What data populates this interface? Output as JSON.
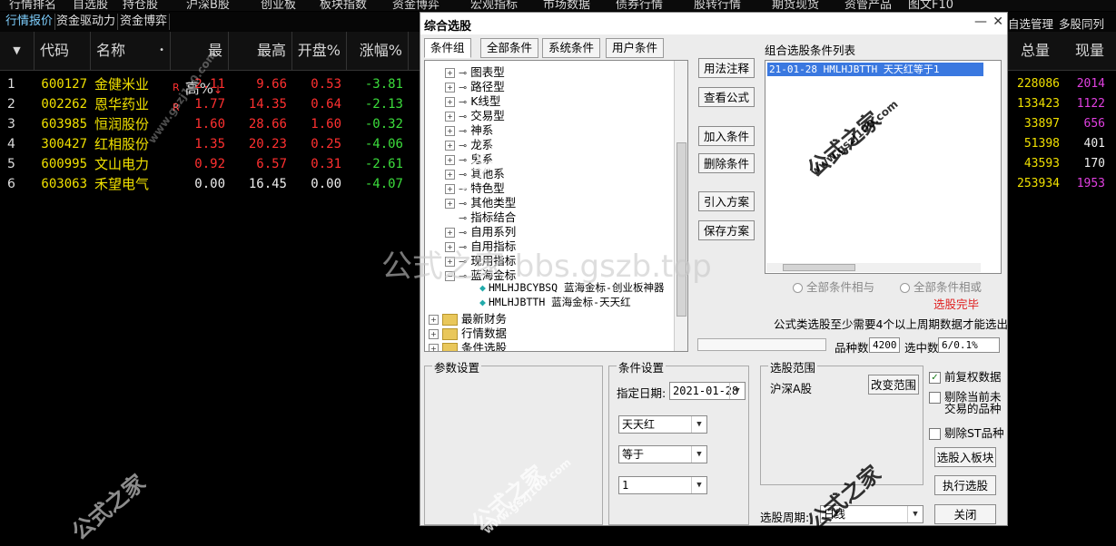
{
  "top_menu": [
    "行情排名",
    "自选股",
    "持仓股",
    "沪深B股",
    "创业板",
    "板块指数",
    "资金博弈",
    "宏观指标",
    "市场数据",
    "债券行情",
    "股转行情",
    "期货现货",
    "资管产品",
    "图文F10"
  ],
  "sub_tabs": [
    "行情报价",
    "资金驱动力",
    "资金博弈"
  ],
  "grid": {
    "columns": [
      "代码",
      "名称",
      "最高%",
      "最高",
      "开盘%",
      "涨幅%"
    ],
    "rows": [
      {
        "idx": "1",
        "code": "600127",
        "name": "金健米业",
        "flag": "R",
        "high_pct": "2.11",
        "high": "9.66",
        "open_pct": "0.53",
        "change": "-3.81",
        "c": "red"
      },
      {
        "idx": "2",
        "code": "002262",
        "name": "恩华药业",
        "flag": "R",
        "high_pct": "1.77",
        "high": "14.35",
        "open_pct": "0.64",
        "change": "-2.13",
        "c": "red"
      },
      {
        "idx": "3",
        "code": "603985",
        "name": "恒润股份",
        "flag": "",
        "high_pct": "1.60",
        "high": "28.66",
        "open_pct": "1.60",
        "change": "-0.32",
        "c": "red"
      },
      {
        "idx": "4",
        "code": "300427",
        "name": "红相股份",
        "flag": "",
        "high_pct": "1.35",
        "high": "20.23",
        "open_pct": "0.25",
        "change": "-4.06",
        "c": "red"
      },
      {
        "idx": "5",
        "code": "600995",
        "name": "文山电力",
        "flag": "",
        "high_pct": "0.92",
        "high": "6.57",
        "open_pct": "0.31",
        "change": "-2.61",
        "c": "red"
      },
      {
        "idx": "6",
        "code": "603063",
        "name": "禾望电气",
        "flag": "",
        "high_pct": "0.00",
        "high": "16.45",
        "open_pct": "0.00",
        "change": "-4.07",
        "c": "white"
      }
    ]
  },
  "right_panel": {
    "menu": [
      "自选管理",
      "多股同列"
    ],
    "columns": [
      "总量",
      "现量"
    ],
    "rows": [
      {
        "total": "228086",
        "cur": "2014"
      },
      {
        "total": "133423",
        "cur": "1122"
      },
      {
        "total": "33897",
        "cur": "656"
      },
      {
        "total": "51398",
        "cur": "401"
      },
      {
        "total": "43593",
        "cur": "170"
      },
      {
        "total": "253934",
        "cur": "1953"
      }
    ]
  },
  "dialog": {
    "title": "综合选股",
    "tabs": [
      "条件组",
      "全部条件",
      "系统条件",
      "用户条件"
    ],
    "tree": [
      "图表型",
      "路径型",
      "K线型",
      "交易型",
      "神系",
      "龙系",
      "鬼系",
      "其他系",
      "特色型",
      "其他类型",
      "指标结合",
      "自用系列",
      "自用指标",
      "现用指标",
      "蓝海金标"
    ],
    "tree_leaves": [
      "HMLHJBCYBSQ 蓝海金标-创业板神器",
      "HMLHJBTTH 蓝海金标-天天红"
    ],
    "tree_folders": [
      "最新财务",
      "行情数据",
      "条件选股"
    ],
    "mid_buttons": [
      "用法注释",
      "查看公式",
      "加入条件",
      "删除条件",
      "引入方案",
      "保存方案"
    ],
    "list_title": "组合选股条件列表",
    "list_item": "21-01-28 HMLHJBTTH 天天红等于1",
    "radio_and": "全部条件相与",
    "radio_or": "全部条件相或",
    "status": "选股完毕",
    "note": "公式类选股至少需要4个以上周期数据才能选出",
    "count_label": "品种数",
    "count_value": "4200",
    "hit_label": "选中数",
    "hit_value": "6/0.1%",
    "param_group": "参数设置",
    "cond_group": "条件设置",
    "date_label": "指定日期:",
    "date_value": "2021-01-28",
    "combo1": "天天红",
    "combo2": "等于",
    "combo3": "1",
    "range_group": "选股范围",
    "range_value": "沪深A股",
    "change_range": "改变范围",
    "chk_fq": "前复权数据",
    "chk_new1": "剔除当前未",
    "chk_new2": "交易的品种",
    "chk_st": "剔除ST品种",
    "to_block": "选股入板块",
    "run": "执行选股",
    "close": "关闭",
    "period_label": "选股周期:",
    "period_value": "日线"
  },
  "watermarks": {
    "brand": "公式之家",
    "site": "www.gszj100.com",
    "bbs": "公式之家 bbs.gszb.top"
  }
}
